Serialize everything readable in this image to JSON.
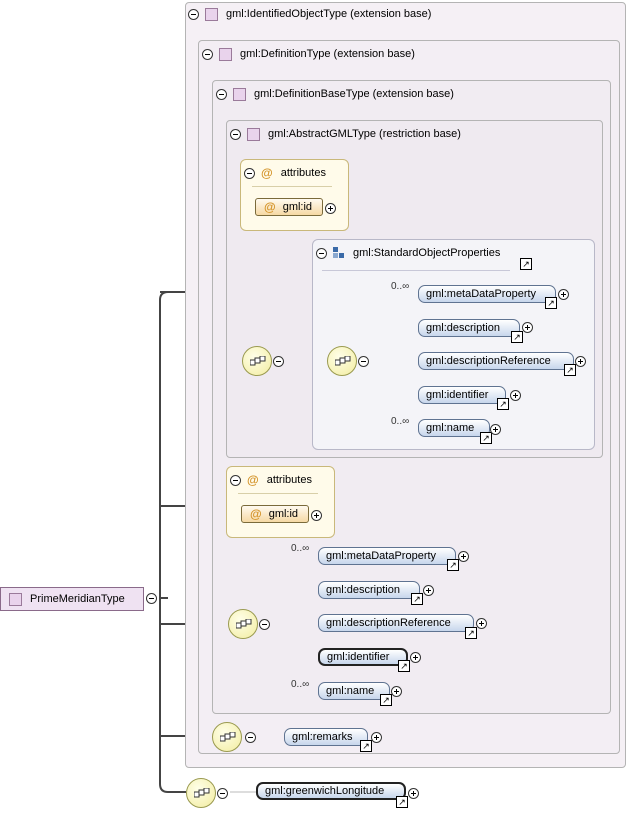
{
  "root": {
    "label": "PrimeMeridianType"
  },
  "containers": {
    "identified": "gml:IdentifiedObjectType (extension base)",
    "definition": "gml:DefinitionType (extension base)",
    "definitionBase": "gml:DefinitionBaseType (extension base)",
    "abstractGml": "gml:AbstractGMLType (restriction base)",
    "standardProps": "gml:StandardObjectProperties"
  },
  "attributes": {
    "title": "attributes",
    "at": "@",
    "id": "gml:id"
  },
  "inner_elements": [
    {
      "label": "gml:metaDataProperty",
      "card": "0..∞"
    },
    {
      "label": "gml:description",
      "card": ""
    },
    {
      "label": "gml:descriptionReference",
      "card": ""
    },
    {
      "label": "gml:identifier",
      "card": ""
    },
    {
      "label": "gml:name",
      "card": "0..∞"
    }
  ],
  "outer_elements": [
    {
      "label": "gml:metaDataProperty",
      "card": "0..∞"
    },
    {
      "label": "gml:description",
      "card": ""
    },
    {
      "label": "gml:descriptionReference",
      "card": ""
    },
    {
      "label": "gml:identifier",
      "card": ""
    },
    {
      "label": "gml:name",
      "card": "0..∞"
    }
  ],
  "remarks": "gml:remarks",
  "greenwich": "gml:greenwichLongitude",
  "icons": {
    "collapse": "minus-circle-icon",
    "expand": "plus-circle-icon",
    "reference": "shortcut-arrow-icon",
    "sequence": "sequence-compositor-icon"
  },
  "colors": {
    "element_fill": "#c7d6ec",
    "attribute_fill": "#f6d9a4",
    "compositor_fill": "#f2eca0",
    "type_fill": "#e9d3ec"
  }
}
